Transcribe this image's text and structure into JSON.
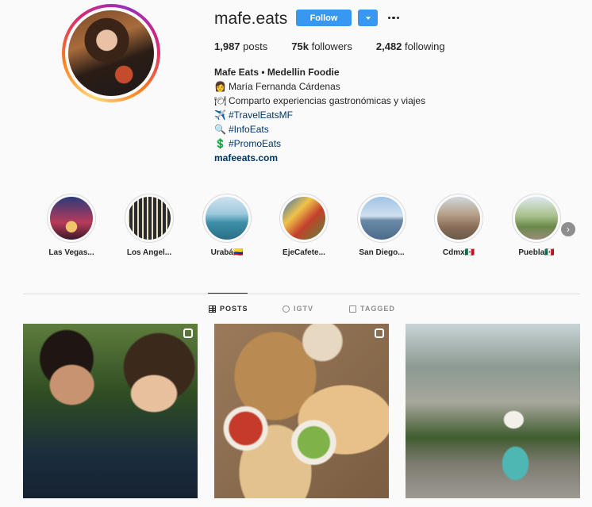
{
  "profile": {
    "username": "mafe.eats",
    "follow_label": "Follow",
    "stats": [
      {
        "count": "1,987",
        "label": "posts"
      },
      {
        "count": "75k",
        "label": "followers"
      },
      {
        "count": "2,482",
        "label": "following"
      }
    ],
    "bio": {
      "name": "Mafe Eats • Medellin Foodie",
      "lines": [
        {
          "emoji": "👩",
          "text": "María Fernanda Cárdenas",
          "is_hashtag": false
        },
        {
          "emoji": "🍽",
          "text": "Comparto experiencias gastronómicas y viajes",
          "is_hashtag": false
        },
        {
          "emoji": "✈️",
          "text": "#TravelEatsMF",
          "is_hashtag": true
        },
        {
          "emoji": "🔍",
          "text": "#InfoEats",
          "is_hashtag": true
        },
        {
          "emoji": "💲",
          "text": "#PromoEats",
          "is_hashtag": true
        }
      ],
      "website": "mafeeats.com"
    }
  },
  "highlights": [
    {
      "label": "Las Vegas...",
      "color": "#7a2a4a"
    },
    {
      "label": "Los Angel...",
      "color": "#2b2b2b"
    },
    {
      "label": "Urabá🇨🇴",
      "color": "#4a9fb5"
    },
    {
      "label": "EjeCafete...",
      "color": "#b84a2e"
    },
    {
      "label": "San Diego...",
      "color": "#5a8fb8"
    },
    {
      "label": "Cdmx🇲🇽",
      "color": "#8a7a6a"
    },
    {
      "label": "Puebla🇲🇽",
      "color": "#7a9a5a"
    }
  ],
  "tabs": [
    {
      "label": "POSTS",
      "icon": "grid-icon",
      "active": true
    },
    {
      "label": "IGTV",
      "icon": "igtv-icon",
      "active": false
    },
    {
      "label": "TAGGED",
      "icon": "tagged-icon",
      "active": false
    }
  ],
  "posts": [
    {
      "type": "igtv",
      "badge_icon": "igtv-icon"
    },
    {
      "type": "carousel",
      "badge_icon": "carousel-icon"
    },
    {
      "type": "photo"
    }
  ],
  "colors": {
    "accent": "#3897f0",
    "link": "#00376b",
    "text": "#262626",
    "muted": "#8e8e8e",
    "border": "#dbdbdb"
  }
}
